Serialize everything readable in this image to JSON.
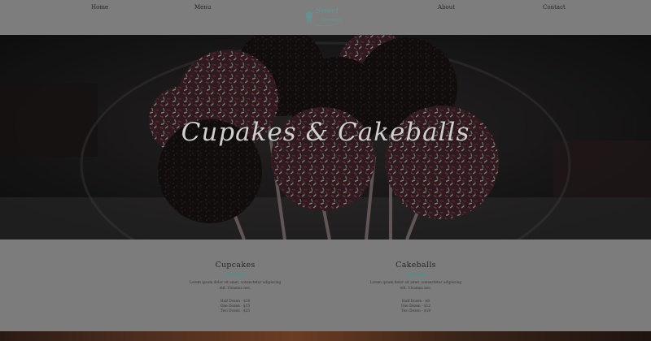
{
  "nav": {
    "links": [
      "Home",
      "Menu",
      "About",
      "Contact"
    ],
    "logo": {
      "line1": "Sweet",
      "line2": "Moments"
    }
  },
  "hero": {
    "title": "Cupakes & Cakeballs"
  },
  "products": [
    {
      "heading": "Cupcakes",
      "description": "Lorem ipsum dolor sit amet, consectetur adipiscing elit. Vivamus nec.",
      "prices": [
        "Half Dozen - $10",
        "One Dozen - $15",
        "Two Dozen - $25"
      ]
    },
    {
      "heading": "Cakeballs",
      "description": "Lorem ipsum dolor sit amet, consectetur adipiscing elit. Vivamus nec.",
      "prices": [
        "Half Dozen - $8",
        "One Dozen - $12",
        "Two Dozen - $18"
      ]
    }
  ],
  "colors": {
    "accent": "#4b8f8e",
    "background": "#7c7c7c",
    "hero_overlay": "#141414"
  }
}
